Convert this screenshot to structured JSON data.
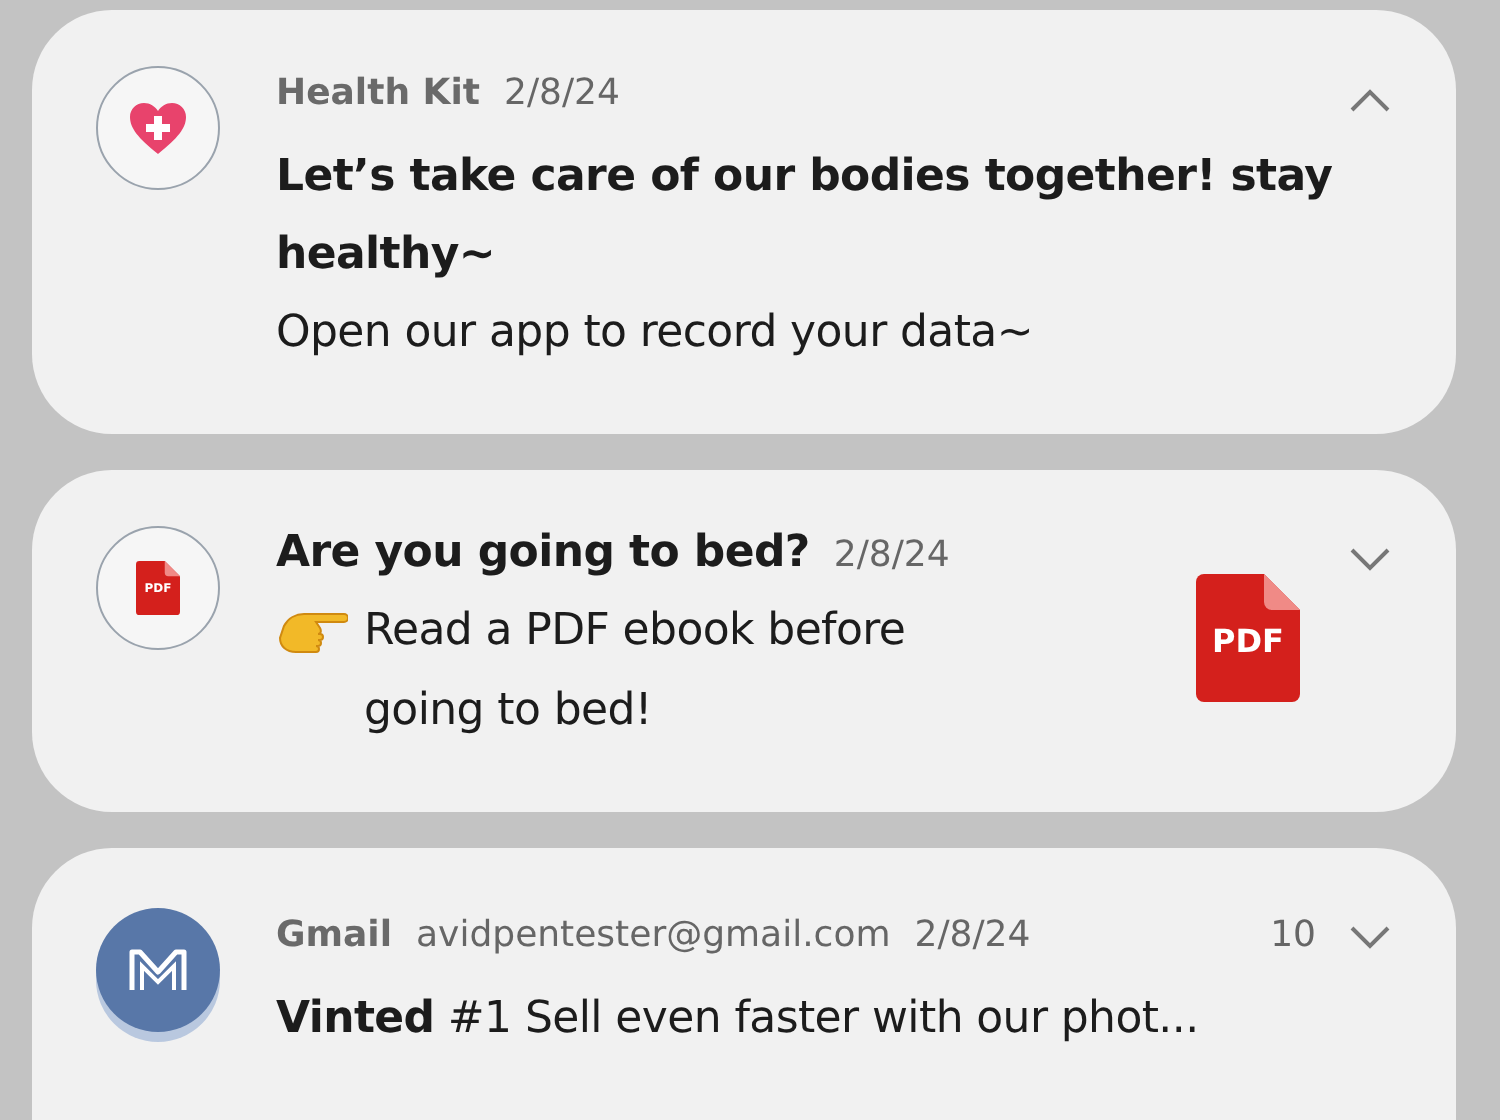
{
  "notifications": [
    {
      "kind": "app_message",
      "app": "Health Kit",
      "date": "2/8/24",
      "expanded": true,
      "headline": "Let’s take care of our bodies together! stay healthy~",
      "body": "Open our app to record your data~"
    },
    {
      "kind": "titled_message",
      "title": "Are you going to bed?",
      "date": "2/8/24",
      "expanded": false,
      "body": "Read a PDF ebook before going to bed!",
      "thumbnail_label": "PDF",
      "icon_label": "PDF"
    },
    {
      "kind": "email",
      "app": "Gmail",
      "account": "avidpentester@gmail.com",
      "date": "2/8/24",
      "count": "10",
      "expanded": false,
      "headline": "**Vinted** #1 Sell even faster with our phot..."
    }
  ]
}
